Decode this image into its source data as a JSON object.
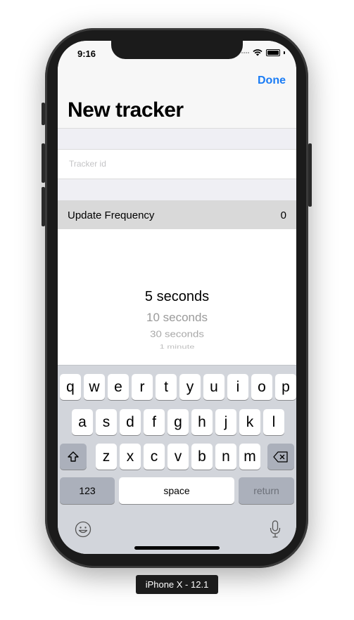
{
  "status": {
    "time": "9:16"
  },
  "nav": {
    "done_label": "Done",
    "title": "New tracker"
  },
  "form": {
    "tracker_id": {
      "value": "",
      "placeholder": "Tracker id"
    },
    "frequency": {
      "label": "Update Frequency",
      "value": "0"
    }
  },
  "picker": {
    "options": [
      "5 seconds",
      "10 seconds",
      "30 seconds",
      "1 minute"
    ],
    "selected": "5 seconds"
  },
  "keyboard": {
    "row1": [
      "q",
      "w",
      "e",
      "r",
      "t",
      "y",
      "u",
      "i",
      "o",
      "p"
    ],
    "row2": [
      "a",
      "s",
      "d",
      "f",
      "g",
      "h",
      "j",
      "k",
      "l"
    ],
    "row3": [
      "z",
      "x",
      "c",
      "v",
      "b",
      "n",
      "m"
    ],
    "numbers_label": "123",
    "space_label": "space",
    "return_label": "return",
    "icons": {
      "shift": "shift-icon",
      "delete": "delete-icon",
      "emoji": "emoji-icon",
      "mic": "microphone-icon"
    }
  },
  "device_label": "iPhone X - 12.1",
  "colors": {
    "accent": "#1a7cf5",
    "keyboard_bg": "#d2d5db",
    "selected_row": "#d9d9d9"
  }
}
